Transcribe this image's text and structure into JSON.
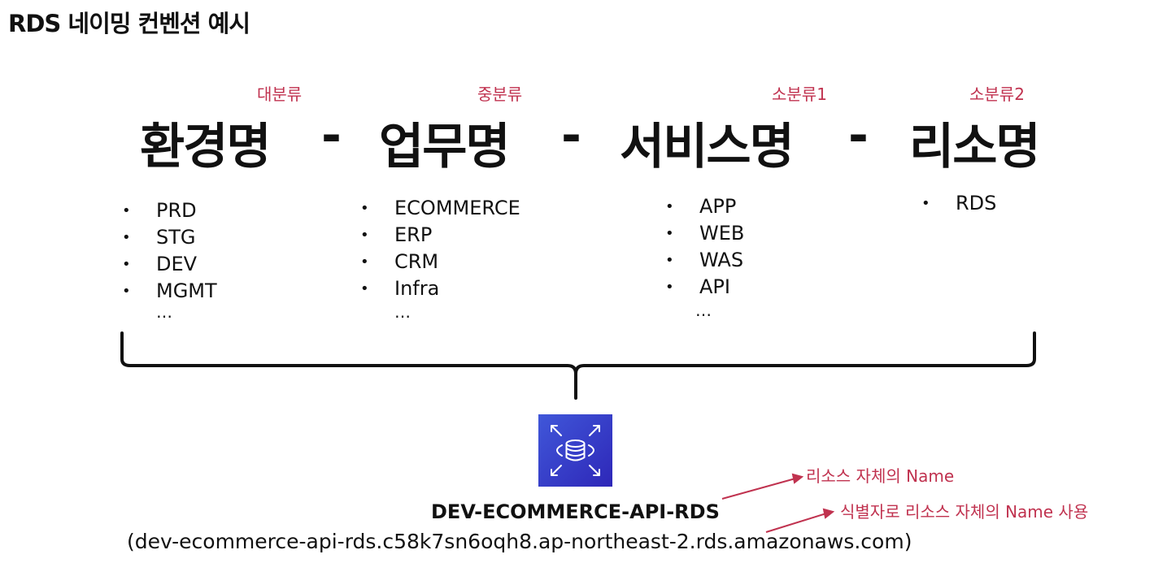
{
  "title": "RDS 네이밍 컨벤션 예시",
  "categories": [
    "대분류",
    "중분류",
    "소분류1",
    "소분류2"
  ],
  "headings": [
    "환경명",
    "업무명",
    "서비스명",
    "리소명"
  ],
  "separator": "-",
  "columns": [
    {
      "items": [
        "PRD",
        "STG",
        "DEV",
        "MGMT"
      ],
      "more": "…"
    },
    {
      "items": [
        "ECOMMERCE",
        "ERP",
        "CRM",
        "Infra"
      ],
      "more": "…"
    },
    {
      "items": [
        "APP",
        "WEB",
        "WAS",
        "API"
      ],
      "more": "…"
    },
    {
      "items": [
        "RDS"
      ],
      "more": ""
    }
  ],
  "icon": "aws-rds-database-icon",
  "resource_name": "DEV-ECOMMERCE-API-RDS",
  "endpoint": "(dev-ecommerce-api-rds.c58k7sn6oqh8.ap-northeast-2.rds.amazonaws.com)",
  "annotations": {
    "name_label": "리소스  자체의 Name",
    "identifier_label": "식별자로 리소스 자체의 Name 사용"
  },
  "colors": {
    "accent": "#c0324f",
    "rds_icon": "#3b48cc"
  }
}
